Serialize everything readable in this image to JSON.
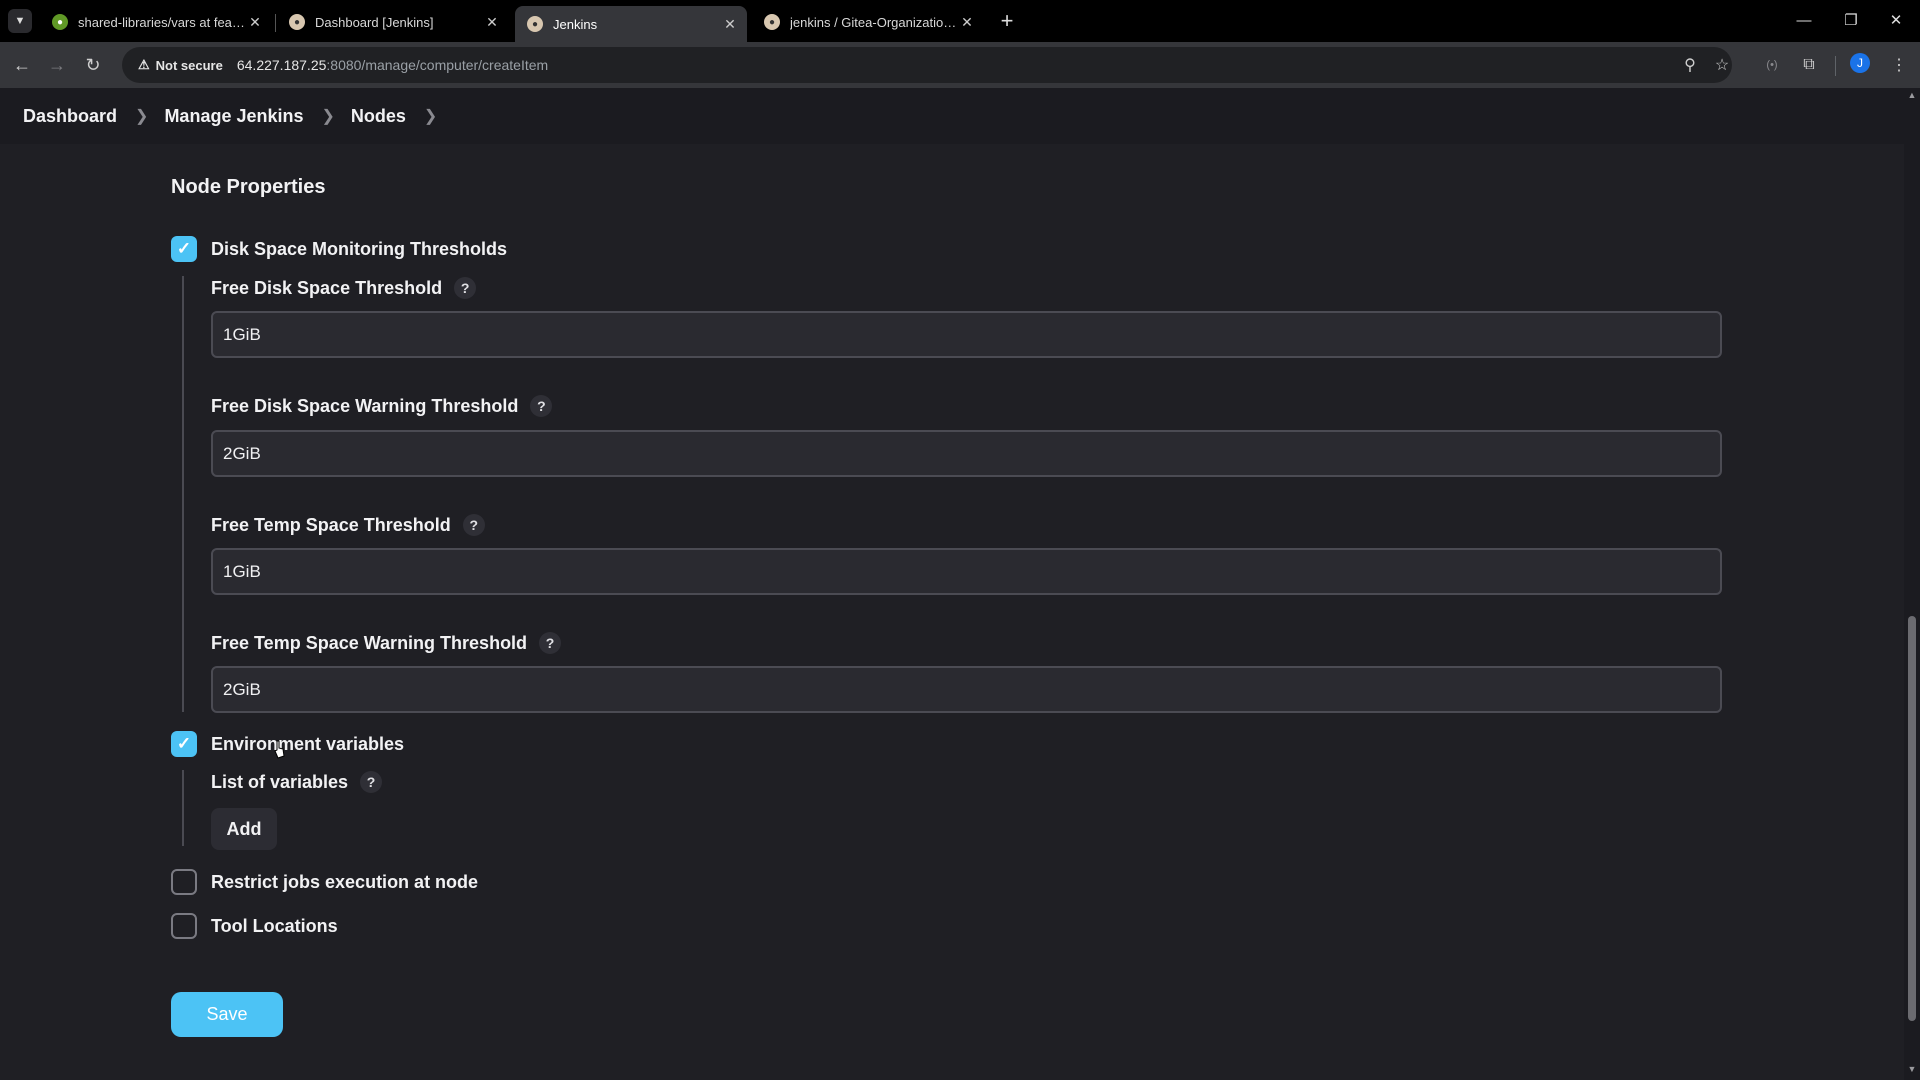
{
  "browser": {
    "tabs": [
      {
        "title": "shared-libraries/vars at feature",
        "favicon_color": "#609926"
      },
      {
        "title": "Dashboard [Jenkins]",
        "favicon_color": "#d8c7b0"
      },
      {
        "title": "Jenkins",
        "favicon_color": "#d8c7b0",
        "active": true
      },
      {
        "title": "jenkins / Gitea-Organization/sc",
        "favicon_color": "#d8c7b0"
      }
    ],
    "security_label": "Not secure",
    "url_host": "64.227.187.25",
    "url_path": ":8080/manage/computer/createItem",
    "profile_initial": "J"
  },
  "breadcrumbs": [
    "Dashboard",
    "Manage Jenkins",
    "Nodes"
  ],
  "page": {
    "section_title": "Node Properties",
    "disk_space": {
      "label": "Disk Space Monitoring Thresholds",
      "checked": true,
      "fields": [
        {
          "label": "Free Disk Space Threshold",
          "value": "1GiB"
        },
        {
          "label": "Free Disk Space Warning Threshold",
          "value": "2GiB"
        },
        {
          "label": "Free Temp Space Threshold",
          "value": "1GiB"
        },
        {
          "label": "Free Temp Space Warning Threshold",
          "value": "2GiB"
        }
      ]
    },
    "env_vars": {
      "label": "Environment variables",
      "checked": true,
      "list_label": "List of variables",
      "add_label": "Add"
    },
    "restrict_jobs": {
      "label": "Restrict jobs execution at node",
      "checked": false
    },
    "tool_locations": {
      "label": "Tool Locations",
      "checked": false
    },
    "save_label": "Save",
    "help_glyph": "?"
  },
  "colors": {
    "accent": "#4cc3f5",
    "background": "#1f1f24"
  }
}
